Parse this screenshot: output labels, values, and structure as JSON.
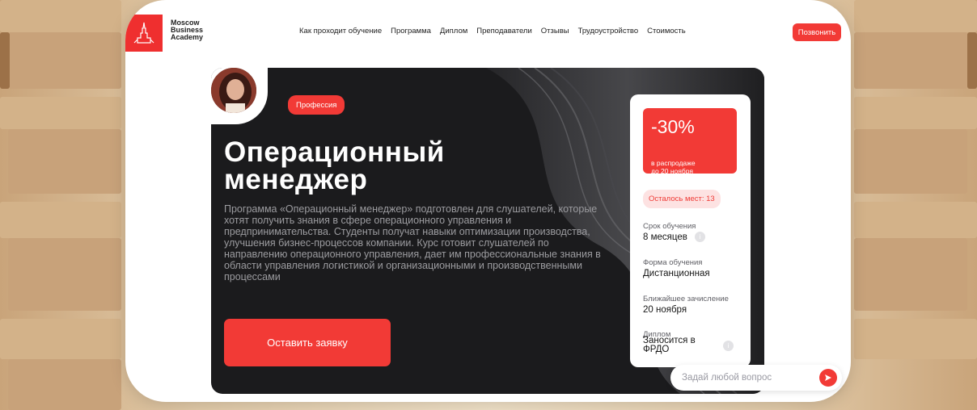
{
  "brand": {
    "line1": "Moscow",
    "line2": "Business",
    "line3": "Academy",
    "accent": "#f23a36"
  },
  "nav": {
    "items": [
      "Как проходит обучение",
      "Программа",
      "Диплом",
      "Преподаватели",
      "Отзывы",
      "Трудоустройство",
      "Стоимость"
    ],
    "call_label": "Позвонить"
  },
  "hero": {
    "badge": "Профессия",
    "title_line1": "Операционный",
    "title_line2": "менеджер",
    "description": "Программа «Операционный менеджер» подготовлен для слушателей, которые хотят получить знания в сфере операционного управления и предпринимательства. Студенты получат навыки оптимизации производства, улучшения бизнес-процессов компании. Курс готовит слушателей по направлению операционного управления, дает им профессиональные знания в области управления логистикой и организационными и производственными процессами",
    "apply_label": "Оставить заявку"
  },
  "info": {
    "discount": "-30%",
    "discount_sub_line1": "в распродаже",
    "discount_sub_line2": "до 20 ноября",
    "seats": "Осталось мест: 13",
    "duration_label": "Срок обучения",
    "duration_value": "8 месяцев",
    "form_label": "Форма обучения",
    "form_value": "Дистанционная",
    "enroll_label": "Ближайшее зачисление",
    "enroll_value": "20 ноября",
    "diploma_label": "Диплом",
    "diploma_value_line1": "Заносится в",
    "diploma_value_line2": "ФРДО",
    "info_icon": "i"
  },
  "chat": {
    "placeholder": "Задай любой вопрос"
  }
}
